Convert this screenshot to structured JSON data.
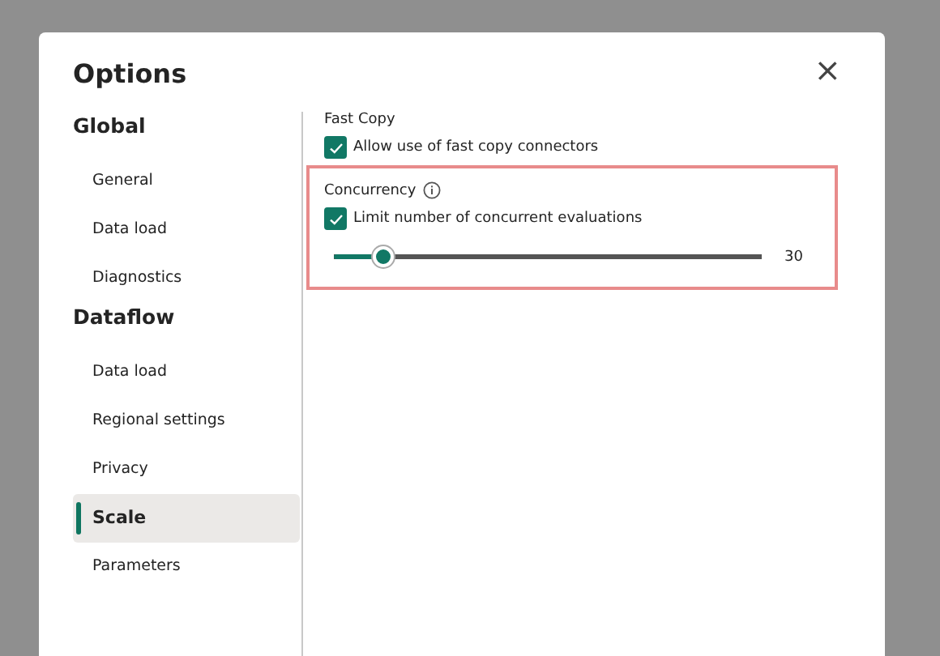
{
  "dialog": {
    "title": "Options",
    "close": "×"
  },
  "sidebar": {
    "groups": [
      {
        "heading": "Global",
        "items": [
          {
            "label": "General",
            "selected": false
          },
          {
            "label": "Data load",
            "selected": false
          },
          {
            "label": "Diagnostics",
            "selected": false
          }
        ]
      },
      {
        "heading": "Dataflow",
        "items": [
          {
            "label": "Data load",
            "selected": false
          },
          {
            "label": "Regional settings",
            "selected": false
          },
          {
            "label": "Privacy",
            "selected": false
          },
          {
            "label": "Scale",
            "selected": true
          },
          {
            "label": "Parameters",
            "selected": false
          }
        ]
      }
    ]
  },
  "sections": [
    {
      "heading": "Fast Copy",
      "checkbox": {
        "label": "Allow use of fast copy connectors",
        "checked": true
      }
    },
    {
      "heading": "Concurrency",
      "info": true,
      "highlighted": true,
      "checkbox": {
        "label": "Limit number of concurrent evaluations",
        "checked": true
      },
      "slider": {
        "level": 0.117,
        "reading": "30"
      }
    }
  ]
}
